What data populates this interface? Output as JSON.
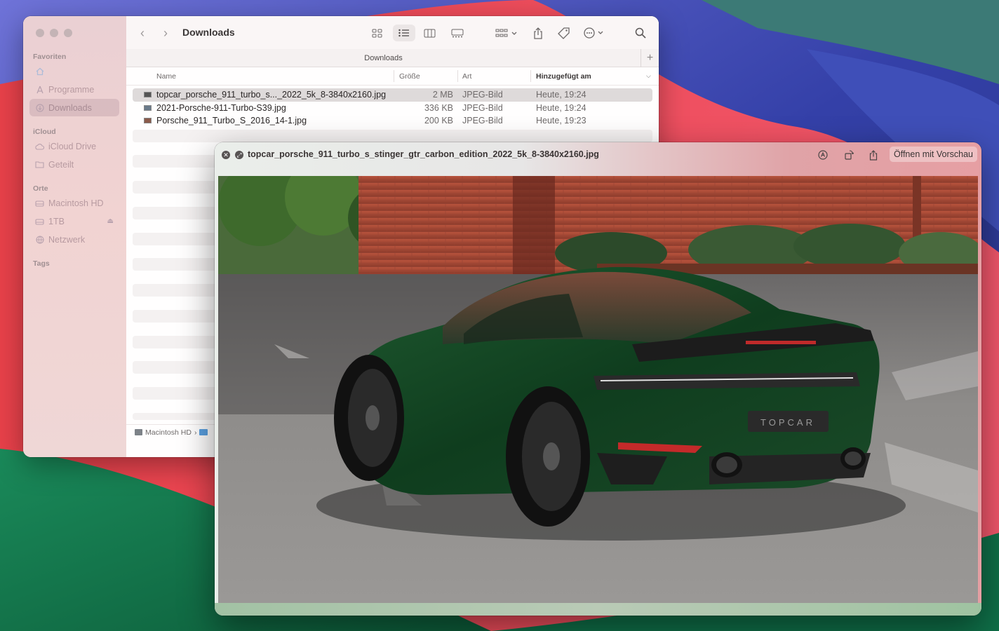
{
  "finder": {
    "sidebar": {
      "sections": [
        {
          "title": "Favoriten"
        },
        {
          "title": "iCloud"
        },
        {
          "title": "Orte"
        },
        {
          "title": "Tags"
        }
      ],
      "favorites": [
        {
          "label": "",
          "icon": "home-icon"
        },
        {
          "label": "Programme",
          "icon": "apps-icon"
        },
        {
          "label": "Downloads",
          "icon": "download-icon",
          "active": true
        }
      ],
      "icloud": [
        {
          "label": "iCloud Drive",
          "icon": "cloud-icon"
        },
        {
          "label": "Geteilt",
          "icon": "shared-folder-icon"
        }
      ],
      "places": [
        {
          "label": "Macintosh HD",
          "icon": "disk-icon"
        },
        {
          "label": "1TB",
          "icon": "disk-icon"
        },
        {
          "label": "Netzwerk",
          "icon": "network-icon"
        }
      ]
    },
    "toolbar": {
      "title": "Downloads",
      "back": "‹",
      "forward": "›"
    },
    "tab": {
      "label": "Downloads",
      "add": "+"
    },
    "columns": {
      "name": "Name",
      "size": "Größe",
      "kind": "Art",
      "date": "Hinzugefügt am"
    },
    "files": [
      {
        "name": "topcar_porsche_911_turbo_s..._2022_5k_8-3840x2160.jpg",
        "size": "2 MB",
        "kind": "JPEG-Bild",
        "date": "Heute, 19:24"
      },
      {
        "name": "2021-Porsche-911-Turbo-S39.jpg",
        "size": "336 KB",
        "kind": "JPEG-Bild",
        "date": "Heute, 19:24"
      },
      {
        "name": "Porsche_911_Turbo_S_2016_14-1.jpg",
        "size": "200 KB",
        "kind": "JPEG-Bild",
        "date": "Heute, 19:23"
      }
    ],
    "path": {
      "disk": "Macintosh HD",
      "sep": "›"
    }
  },
  "quicklook": {
    "title": "topcar_porsche_911_turbo_s_stinger_gtr_carbon_edition_2022_5k_8-3840x2160.jpg",
    "open_with": "Öffnen mit Vorschau",
    "image_subject": "Green carbon Porsche 911 Turbo S Stinger GTR in front of brick building",
    "plate": "TOPCAR"
  }
}
